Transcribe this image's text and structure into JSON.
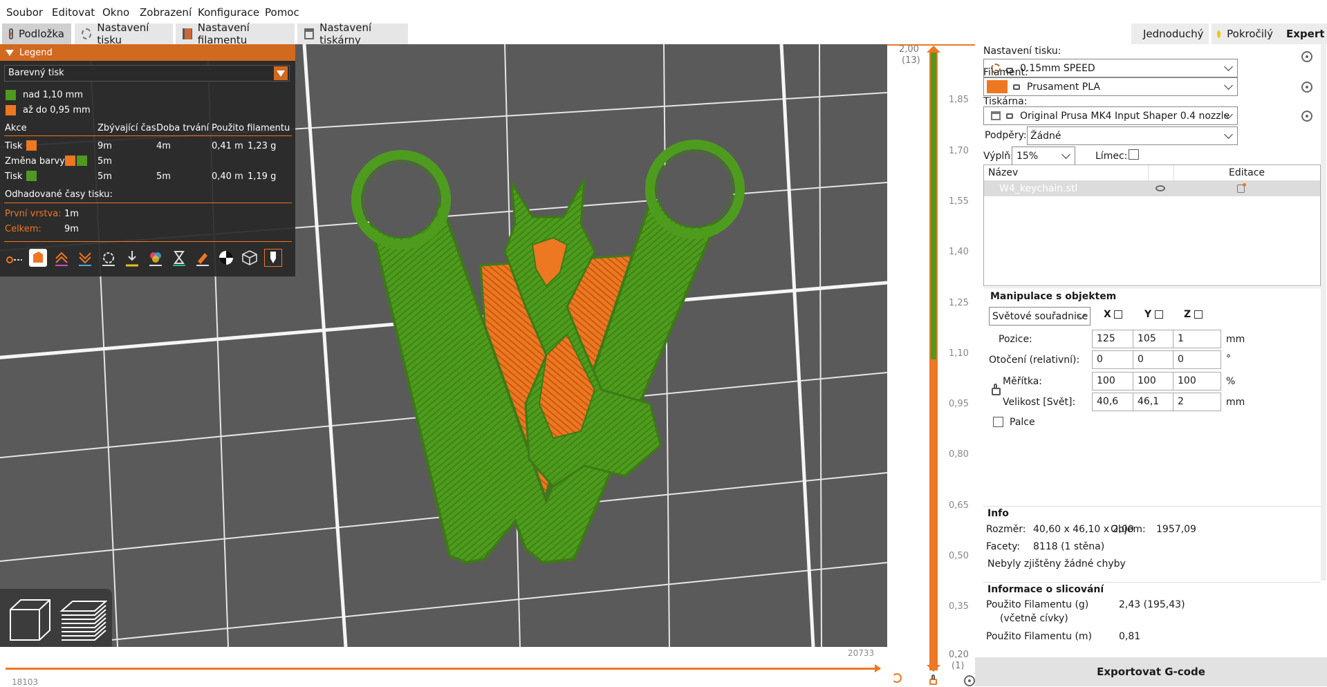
{
  "menu": [
    "Soubor",
    "Editovat",
    "Okno",
    "Zobrazení",
    "Konfigurace",
    "Pomoc"
  ],
  "tabs": [
    "Podložka",
    "Nastavení tisku",
    "Nastavení filamentu",
    "Nastavení tiskárny"
  ],
  "modes": [
    {
      "label": "Jednoduchý",
      "color": "#3cb93c"
    },
    {
      "label": "Pokročilý",
      "color": "#f2c400"
    },
    {
      "label": "Expert",
      "color": "#e0142c"
    }
  ],
  "legend": {
    "title": "Legend",
    "view_type": "Barevný tisk",
    "ranges": [
      {
        "label": "nad 1,10 mm",
        "color": "#4d9a1f"
      },
      {
        "label": "až do 0,95 mm",
        "color": "#ee7722"
      }
    ],
    "columns": [
      "Akce",
      "Zbývající čas",
      "Doba trvání",
      "Použito filamentu"
    ],
    "rows": [
      {
        "action": "Tisk",
        "remaining": "9m",
        "duration": "4m",
        "length": "0,41 m",
        "weight": "1,23 g"
      },
      {
        "action": "Změna barvy",
        "remaining": "5m",
        "duration": "",
        "length": "",
        "weight": ""
      },
      {
        "action": "Tisk",
        "remaining": "5m",
        "duration": "5m",
        "length": "0,40 m",
        "weight": "1,19 g"
      }
    ],
    "estimated_title": "Odhadované časy tisku:",
    "first_layer_label": "První vrstva:",
    "first_layer_value": "1m",
    "total_label": "Celkem:",
    "total_value": "9m",
    "toolbar_icons": [
      "travel-icon",
      "wipe-icon",
      "retractions-icon",
      "deretractions-icon",
      "seams-icon",
      "tool-changes-icon",
      "color-changes-icon",
      "pause-prints-icon",
      "custom-gcodes-icon",
      "center-of-gravity-icon",
      "shells-icon",
      "tool-marker-icon"
    ]
  },
  "viewport": {
    "horizontal_slider_left": "18103",
    "horizontal_slider_right": "20733"
  },
  "vertical_slider": {
    "top_value": "2,00",
    "top_layer": "(13)",
    "bottom_value": "0,20",
    "bottom_layer": "(1)",
    "ticks": [
      "2,00",
      "1,85",
      "1,70",
      "1,55",
      "1,40",
      "1,25",
      "1,10",
      "0,95",
      "0,80",
      "0,65",
      "0,50",
      "0,35",
      "0,20"
    ],
    "green_color": "#4d9a1f",
    "orange_color": "#ee7722",
    "change_height": "1,10"
  },
  "right_panel": {
    "print_settings_label": "Nastavení tisku:",
    "print_settings_value": "0.15mm SPEED",
    "filament_label": "Filament:",
    "filament_value": "Prusament PLA",
    "filament_color": "#ee7722",
    "printer_label": "Tiskárna:",
    "printer_value": "Original Prusa MK4 Input Shaper 0.4 nozzle",
    "supports_label": "Podpěry:",
    "supports_value": "Žádné",
    "infill_label": "Výplň:",
    "infill_value": "15%",
    "brim_label": "Límec:",
    "object_list_name_header": "Název",
    "object_list_edit_header": "Editace",
    "object_name": "W4_keychain.stl",
    "manip_title": "Manipulace s objektem",
    "coord_system": "Světové souřadnice",
    "axes": [
      "X",
      "Y",
      "Z"
    ],
    "position_label": "Pozice:",
    "position": [
      "125",
      "105",
      "1"
    ],
    "position_unit": "mm",
    "rotation_label": "Otočení (relativní):",
    "rotation": [
      "0",
      "0",
      "0"
    ],
    "rotation_unit": "°",
    "scale_label": "Měřítka:",
    "scale": [
      "100",
      "100",
      "100"
    ],
    "scale_unit": "%",
    "size_label": "Velikost [Svět]:",
    "size": [
      "40,6",
      "46,1",
      "2"
    ],
    "size_unit": "mm",
    "inches_label": "Palce",
    "info_title": "Info",
    "size_info_label": "Rozměr:",
    "size_info_value": "40,60 x 46,10 x 2,00",
    "volume_label": "Objem:",
    "volume_value": "1957,09",
    "facets_label": "Facety:",
    "facets_value": "8118 (1 stěna)",
    "errors_text": "Nebyly zjištěny žádné chyby",
    "slice_info_title": "Informace o slicování",
    "filament_g_label": "Použito Filamentu (g)",
    "filament_g_sub": "(včetně cívky)",
    "filament_g_value": "2,43 (195,43)",
    "filament_m_label": "Použito Filamentu (m)",
    "filament_m_value": "0,81",
    "export_button": "Exportovat G-code"
  }
}
